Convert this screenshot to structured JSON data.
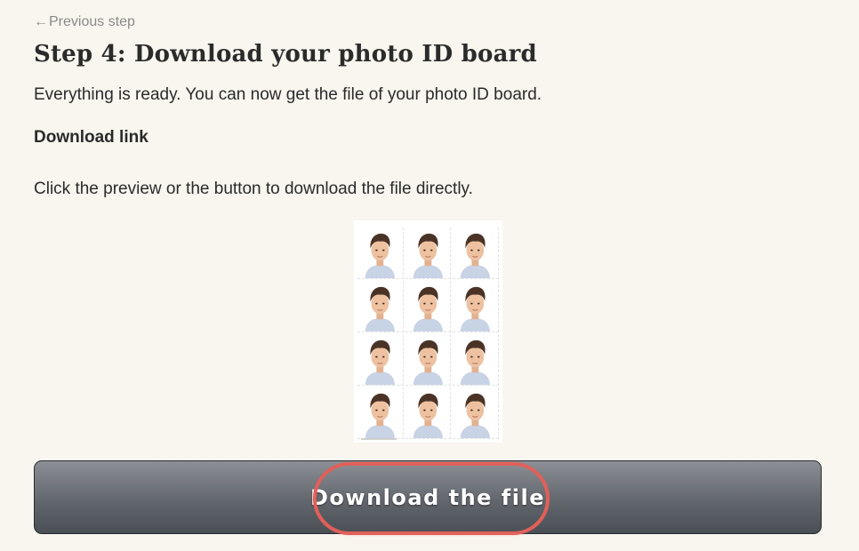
{
  "nav": {
    "back_arrow": "←",
    "back_label": "Previous step"
  },
  "header": {
    "title": "Step 4: Download your photo ID board"
  },
  "content": {
    "intro": "Everything is ready. You can now get the file of your photo ID board.",
    "subheading": "Download link",
    "instruction": "Click the preview or the button to download the file directly."
  },
  "preview": {
    "rows": 4,
    "cols": 3,
    "icon": "photo-id-board-thumbnail"
  },
  "download_button": {
    "label": "Download the file"
  },
  "colors": {
    "background": "#f9f6ef",
    "button_top": "#8c9096",
    "button_bottom": "#4a4e55",
    "highlight": "#e0605a"
  }
}
